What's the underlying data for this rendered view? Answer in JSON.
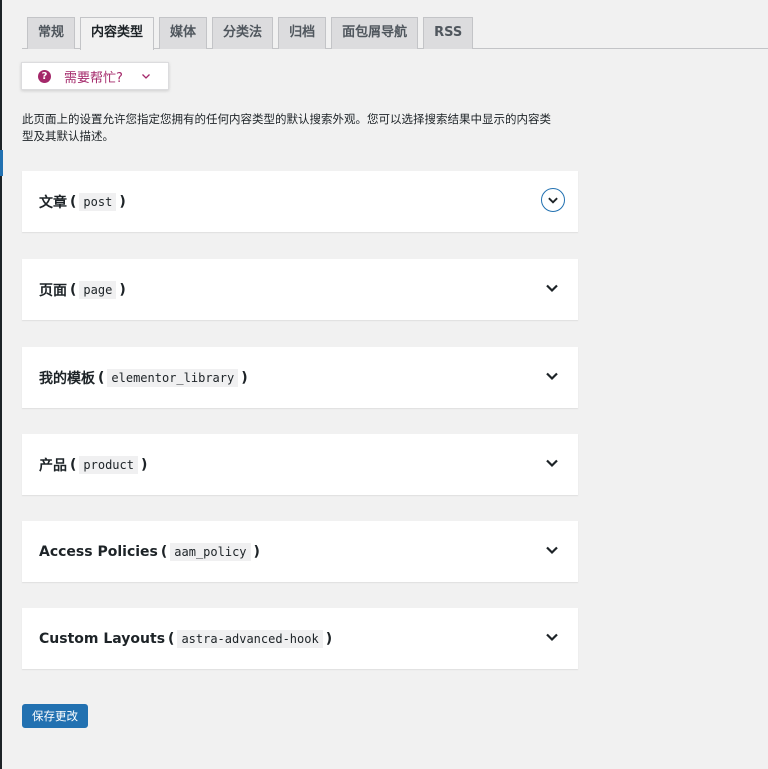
{
  "tabs": [
    {
      "label": "常规",
      "active": false
    },
    {
      "label": "内容类型",
      "active": true
    },
    {
      "label": "媒体",
      "active": false
    },
    {
      "label": "分类法",
      "active": false
    },
    {
      "label": "归档",
      "active": false
    },
    {
      "label": "面包屑导航",
      "active": false
    },
    {
      "label": "RSS",
      "active": false
    }
  ],
  "help": {
    "icon": "?",
    "label": "需要帮忙?"
  },
  "intro_text": "此页面上的设置允许您指定您拥有的任何内容类型的默认搜索外观。您可以选择搜索结果中显示的内容类型及其默认描述。",
  "panels": [
    {
      "name": "文章",
      "slug": "post"
    },
    {
      "name": "页面",
      "slug": "page"
    },
    {
      "name": "我的模板",
      "slug": "elementor_library"
    },
    {
      "name": "产品",
      "slug": "product"
    },
    {
      "name": "Access Policies",
      "slug": "aam_policy"
    },
    {
      "name": "Custom Layouts",
      "slug": "astra-advanced-hook"
    }
  ],
  "paren_open": "(",
  "paren_close": ")",
  "save_label": "保存更改",
  "colors": {
    "accent": "#2271b1",
    "help": "#a4286a",
    "background": "#f1f1f1"
  }
}
